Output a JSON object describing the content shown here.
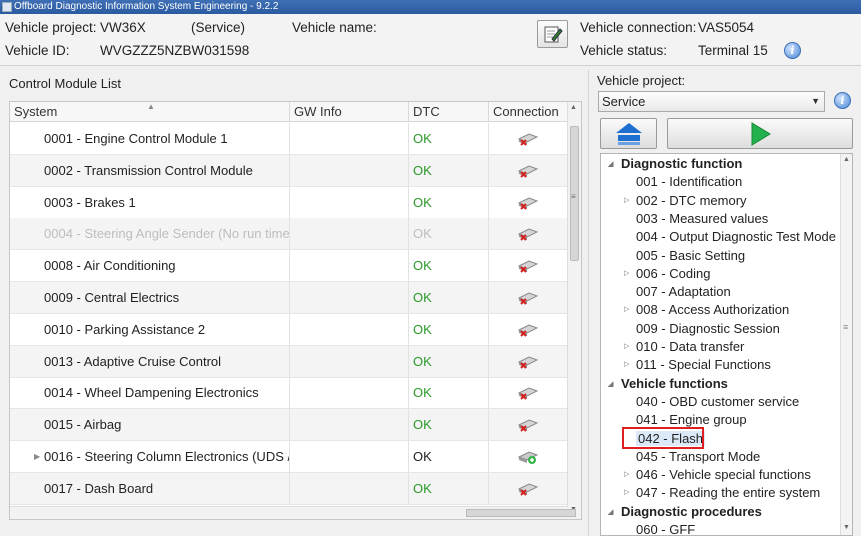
{
  "window": {
    "title": "Offboard Diagnostic Information System Engineering - 9.2.2"
  },
  "header": {
    "vehicle_project_label": "Vehicle project:",
    "vehicle_project_value": "VW36X",
    "vehicle_project_mode": "(Service)",
    "vehicle_name_label": "Vehicle name:",
    "vehicle_id_label": "Vehicle ID:",
    "vehicle_id_value": "WVGZZZ5NZBW031598",
    "vehicle_connection_label": "Vehicle connection:",
    "vehicle_connection_value": "VAS5054",
    "vehicle_status_label": "Vehicle status:",
    "vehicle_status_value": "Terminal 15"
  },
  "control_modules": {
    "title": "Control Module List",
    "columns": [
      "System",
      "GW Info",
      "DTC",
      "Connection"
    ],
    "rows": [
      {
        "system": "0001 - Engine Control Module 1",
        "gw": "",
        "dtc": "OK",
        "state": "normal"
      },
      {
        "system": "0002 - Transmission Control Module",
        "gw": "",
        "dtc": "OK",
        "state": "normal"
      },
      {
        "system": "0003 - Brakes 1",
        "gw": "",
        "dtc": "OK",
        "state": "normal"
      },
      {
        "system": "0004 - Steering Angle Sender  (No run time",
        "gw": "",
        "dtc": "OK",
        "state": "disabled"
      },
      {
        "system": "0008 - Air Conditioning",
        "gw": "",
        "dtc": "OK",
        "state": "normal"
      },
      {
        "system": "0009 - Central Electrics",
        "gw": "",
        "dtc": "OK",
        "state": "normal"
      },
      {
        "system": "0010 - Parking Assistance 2",
        "gw": "",
        "dtc": "OK",
        "state": "normal"
      },
      {
        "system": "0013 - Adaptive Cruise Control",
        "gw": "",
        "dtc": "OK",
        "state": "normal"
      },
      {
        "system": "0014 - Wheel Dampening Electronics",
        "gw": "",
        "dtc": "OK",
        "state": "normal"
      },
      {
        "system": "0015 - Airbag",
        "gw": "",
        "dtc": "OK",
        "state": "normal"
      },
      {
        "system": "0016 - Steering Column Electronics  (UDS /",
        "gw": "",
        "dtc": "OK",
        "state": "expandable"
      },
      {
        "system": "0017 - Dash Board",
        "gw": "",
        "dtc": "OK",
        "state": "normal"
      }
    ]
  },
  "right_panel": {
    "vehicle_project_label": "Vehicle project:",
    "vehicle_project_select": "Service"
  },
  "tree": [
    {
      "label": "Diagnostic function",
      "level": 0,
      "bold": true,
      "toggle": "expanded"
    },
    {
      "label": "001 - Identification",
      "level": 1,
      "toggle": ""
    },
    {
      "label": "002 - DTC memory",
      "level": 1,
      "toggle": "collapsed"
    },
    {
      "label": "003 - Measured values",
      "level": 1,
      "toggle": ""
    },
    {
      "label": "004 - Output Diagnostic Test Mode",
      "level": 1,
      "toggle": ""
    },
    {
      "label": "005 - Basic Setting",
      "level": 1,
      "toggle": ""
    },
    {
      "label": "006 - Coding",
      "level": 1,
      "toggle": "collapsed"
    },
    {
      "label": "007 - Adaptation",
      "level": 1,
      "toggle": ""
    },
    {
      "label": "008 - Access Authorization",
      "level": 1,
      "toggle": "collapsed"
    },
    {
      "label": "009 - Diagnostic Session",
      "level": 1,
      "toggle": ""
    },
    {
      "label": "010 - Data transfer",
      "level": 1,
      "toggle": "collapsed"
    },
    {
      "label": "011 - Special Functions",
      "level": 1,
      "toggle": "collapsed"
    },
    {
      "label": "Vehicle functions",
      "level": 0,
      "bold": true,
      "toggle": "expanded"
    },
    {
      "label": "040 - OBD customer service",
      "level": 1,
      "toggle": ""
    },
    {
      "label": "041 - Engine group",
      "level": 1,
      "toggle": ""
    },
    {
      "label": "042 - Flash",
      "level": 1,
      "toggle": "",
      "selected": true
    },
    {
      "label": "045 - Transport Mode",
      "level": 1,
      "toggle": ""
    },
    {
      "label": "046 - Vehicle special functions",
      "level": 1,
      "toggle": "collapsed"
    },
    {
      "label": "047 - Reading the entire system",
      "level": 1,
      "toggle": "collapsed"
    },
    {
      "label": "Diagnostic procedures",
      "level": 0,
      "bold": true,
      "toggle": "expanded"
    },
    {
      "label": "060 - GFF",
      "level": 1,
      "toggle": ""
    }
  ],
  "colors": {
    "ok_green": "#2a9a2a",
    "highlight_red": "#e02020",
    "play_green": "#22b14c",
    "home_blue": "#1f6fd1"
  }
}
